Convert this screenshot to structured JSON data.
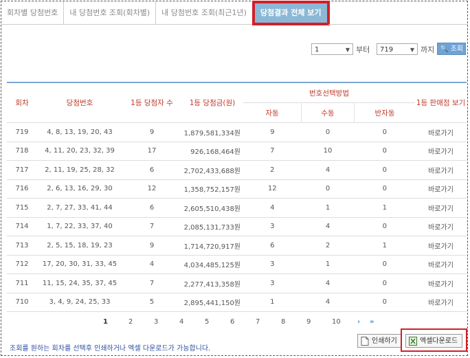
{
  "tabs": [
    "회차별 당첨번호",
    "내 당첨번호 조회(회차별)",
    "내 당첨번호 조회(최근1년)",
    "당첨결과 전체 보기"
  ],
  "filter": {
    "from_value": "1",
    "from_label": "부터",
    "to_value": "719",
    "to_label": "까지",
    "search_label": "조회"
  },
  "table": {
    "headers": {
      "round": "회차",
      "numbers": "당첨번호",
      "winners": "1등 당첨자 수",
      "prize": "1등 당첨금(원)",
      "method": "번호선택방법",
      "auto": "자동",
      "manual": "수동",
      "semi": "반자동",
      "shop": "1등 판매점 보기"
    },
    "rows": [
      {
        "round": "719",
        "numbers": "4, 8, 13, 19, 20, 43",
        "winners": "9",
        "prize": "1,879,581,334원",
        "auto": "9",
        "manual": "0",
        "semi": "0",
        "shop": "바로가기"
      },
      {
        "round": "718",
        "numbers": "4, 11, 20, 23, 32, 39",
        "winners": "17",
        "prize": "926,168,464원",
        "auto": "7",
        "manual": "10",
        "semi": "0",
        "shop": "바로가기"
      },
      {
        "round": "717",
        "numbers": "2, 11, 19, 25, 28, 32",
        "winners": "6",
        "prize": "2,702,433,688원",
        "auto": "2",
        "manual": "4",
        "semi": "0",
        "shop": "바로가기"
      },
      {
        "round": "716",
        "numbers": "2, 6, 13, 16, 29, 30",
        "winners": "12",
        "prize": "1,358,752,157원",
        "auto": "12",
        "manual": "0",
        "semi": "0",
        "shop": "바로가기"
      },
      {
        "round": "715",
        "numbers": "2, 7, 27, 33, 41, 44",
        "winners": "6",
        "prize": "2,605,510,438원",
        "auto": "4",
        "manual": "1",
        "semi": "1",
        "shop": "바로가기"
      },
      {
        "round": "714",
        "numbers": "1, 7, 22, 33, 37, 40",
        "winners": "7",
        "prize": "2,085,131,733원",
        "auto": "3",
        "manual": "4",
        "semi": "0",
        "shop": "바로가기"
      },
      {
        "round": "713",
        "numbers": "2, 5, 15, 18, 19, 23",
        "winners": "9",
        "prize": "1,714,720,917원",
        "auto": "6",
        "manual": "2",
        "semi": "1",
        "shop": "바로가기"
      },
      {
        "round": "712",
        "numbers": "17, 20, 30, 31, 33, 45",
        "winners": "4",
        "prize": "4,034,485,125원",
        "auto": "3",
        "manual": "1",
        "semi": "0",
        "shop": "바로가기"
      },
      {
        "round": "711",
        "numbers": "11, 15, 24, 35, 37, 45",
        "winners": "7",
        "prize": "2,277,413,358원",
        "auto": "3",
        "manual": "4",
        "semi": "0",
        "shop": "바로가기"
      },
      {
        "round": "710",
        "numbers": "3, 4, 9, 24, 25, 33",
        "winners": "5",
        "prize": "2,895,441,150원",
        "auto": "1",
        "manual": "4",
        "semi": "0",
        "shop": "바로가기"
      }
    ]
  },
  "pagination": {
    "pages": [
      "1",
      "2",
      "3",
      "4",
      "5",
      "6",
      "7",
      "8",
      "9",
      "10"
    ],
    "next": "›",
    "last": "»"
  },
  "note": "조회를 원하는 회차를 선택후 인쇄하거나 엑셀 다운로드가 가능합니다.",
  "buttons": {
    "print": "인쇄하기",
    "excel": "엑셀다운로드"
  }
}
